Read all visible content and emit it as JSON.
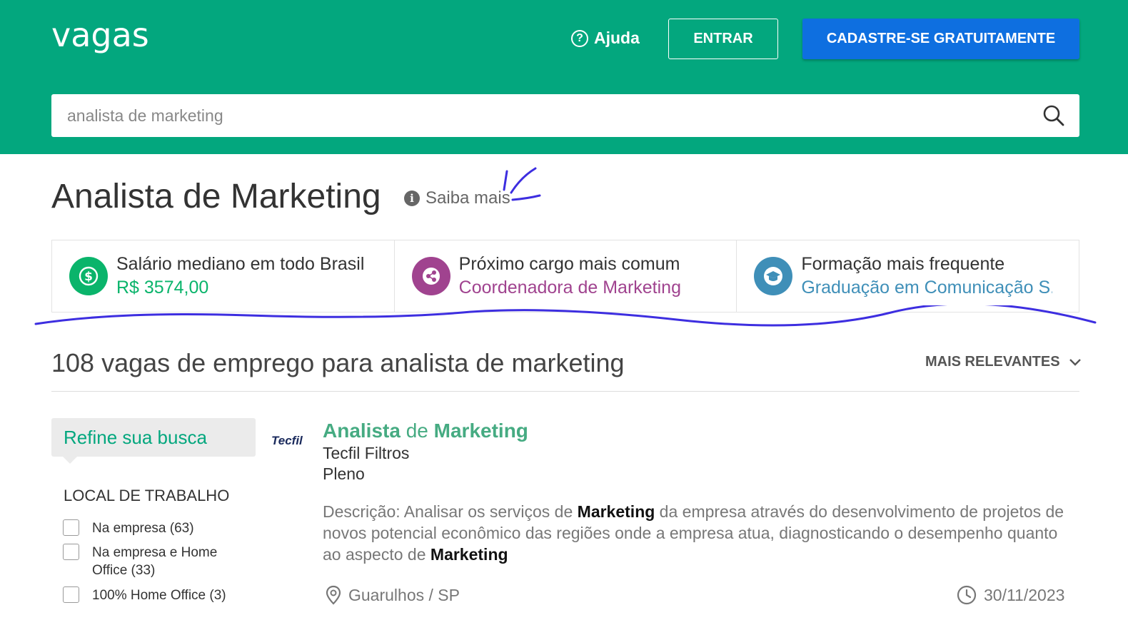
{
  "header": {
    "logo": "vagas",
    "help_label": "Ajuda",
    "login_label": "ENTRAR",
    "signup_label": "CADASTRE-SE GRATUITAMENTE",
    "search_value": "analista de marketing"
  },
  "title": {
    "text": "Analista de Marketing",
    "more_link": "Saiba mais"
  },
  "stats": [
    {
      "label": "Salário mediano em todo Brasil",
      "value": "R$ 3574,00",
      "color": "#0ab46b",
      "icon": "dollar-icon"
    },
    {
      "label": "Próximo cargo mais comum",
      "value": "Coordenadora de Marketing",
      "color": "#a0438f",
      "icon": "share-icon"
    },
    {
      "label": "Formação mais frequente",
      "value": "Graduação em Comunicação S...",
      "color": "#3f8fb8",
      "icon": "graduation-cap-icon"
    }
  ],
  "results": {
    "count_text": "108 vagas de emprego para analista de marketing",
    "sort_label": "MAIS RELEVANTES"
  },
  "sidebar": {
    "refine_label": "Refine sua busca",
    "filter_title": "LOCAL DE TRABALHO",
    "filters": [
      {
        "label": "Na empresa (63)",
        "checked": false
      },
      {
        "label": "Na empresa e Home Office (33)",
        "checked": false
      },
      {
        "label": "100% Home Office (3)",
        "checked": false
      }
    ]
  },
  "job": {
    "company_logo": "Tecfil",
    "title_part1": "Analista",
    "title_part2": "de",
    "title_part3": "Marketing",
    "company": "Tecfil Filtros",
    "level": "Pleno",
    "desc_1": "Descrição: Analisar os serviços de ",
    "desc_kw1": "Marketing",
    "desc_2": " da empresa através do desenvolvimento de projetos de novos potencial econômico das regiões onde a empresa atua, diagnosticando o desempenho quanto ao aspecto de ",
    "desc_kw2": "Marketing",
    "location": "Guarulhos / SP",
    "date": "30/11/2023"
  },
  "colors": {
    "brand_green": "#03a77e",
    "signup_blue": "#0e6fe0",
    "job_title_green": "#46ab82",
    "annotation_ink": "#3d2ee0"
  }
}
